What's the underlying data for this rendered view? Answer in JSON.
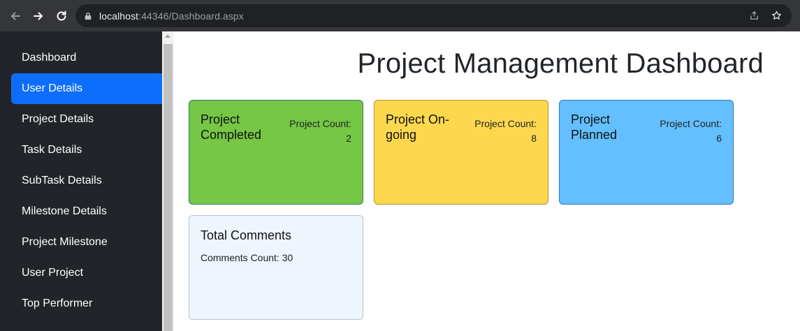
{
  "browser": {
    "url_host": "localhost",
    "url_rest": ":44346/Dashboard.aspx"
  },
  "sidebar": {
    "items": [
      {
        "label": "Dashboard",
        "active": false
      },
      {
        "label": "User Details",
        "active": true
      },
      {
        "label": "Project Details",
        "active": false
      },
      {
        "label": "Task Details",
        "active": false
      },
      {
        "label": "SubTask Details",
        "active": false
      },
      {
        "label": "Milestone Details",
        "active": false
      },
      {
        "label": "Project Milestone",
        "active": false
      },
      {
        "label": "User Project",
        "active": false
      },
      {
        "label": "Top Performer",
        "active": false
      }
    ]
  },
  "main": {
    "title": "Project Management Dashboard",
    "cards": [
      {
        "title": "Project Completed",
        "count_label": "Project Count:",
        "count": "2",
        "color": "#75c745"
      },
      {
        "title": "Project On-going",
        "count_label": "Project Count:",
        "count": "8",
        "color": "#fdd74e"
      },
      {
        "title": "Project Planned",
        "count_label": "Project Count:",
        "count": "6",
        "color": "#63bfff"
      }
    ],
    "comments": {
      "title": "Total Comments",
      "text": "Comments Count: 30",
      "color": "#eef5fd"
    }
  },
  "colors": {
    "sidebar_bg": "#212529",
    "active_item": "#0d6efd",
    "browser_bg": "#35363a"
  }
}
